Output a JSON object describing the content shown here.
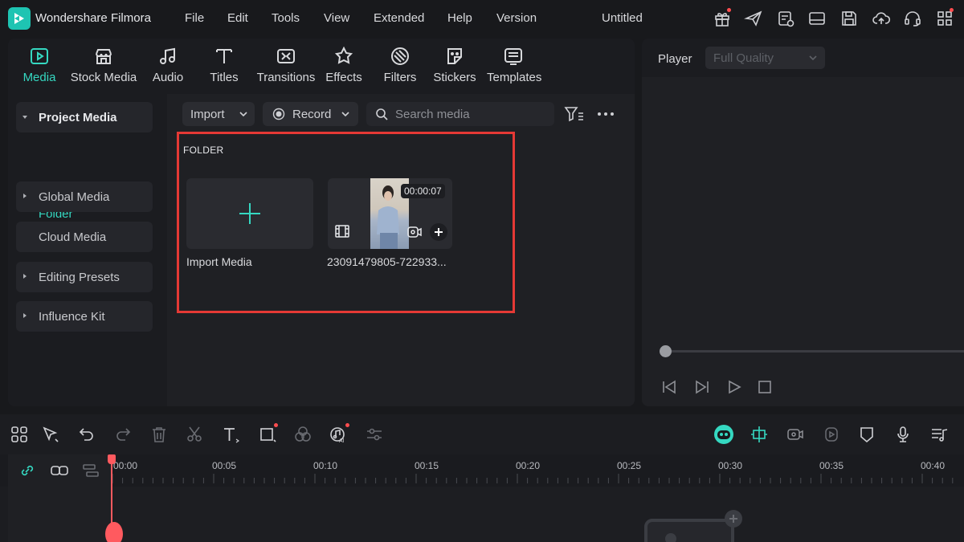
{
  "app": {
    "name": "Wondershare Filmora",
    "document_title": "Untitled"
  },
  "menu": [
    "File",
    "Edit",
    "Tools",
    "View",
    "Extended",
    "Help",
    "Version"
  ],
  "media_toolbar": {
    "items": [
      {
        "label": "Media",
        "icon": "media-icon",
        "active": true
      },
      {
        "label": "Stock Media",
        "icon": "stock-media-icon"
      },
      {
        "label": "Audio",
        "icon": "audio-icon"
      },
      {
        "label": "Titles",
        "icon": "titles-icon"
      },
      {
        "label": "Transitions",
        "icon": "transitions-icon"
      },
      {
        "label": "Effects",
        "icon": "effects-icon"
      },
      {
        "label": "Filters",
        "icon": "filters-icon"
      },
      {
        "label": "Stickers",
        "icon": "stickers-icon"
      },
      {
        "label": "Templates",
        "icon": "templates-icon"
      }
    ]
  },
  "sidebar": {
    "items": [
      {
        "label": "Project Media",
        "expanded": true
      },
      {
        "label": "Folder",
        "selected": true
      },
      {
        "label": "Global Media"
      },
      {
        "label": "Cloud Media"
      },
      {
        "label": "Editing Presets"
      },
      {
        "label": "Influence Kit"
      }
    ]
  },
  "media_bar": {
    "import_label": "Import",
    "record_label": "Record",
    "search_placeholder": "Search media"
  },
  "folder": {
    "title": "FOLDER",
    "import_tile_label": "Import Media",
    "clip": {
      "name": "23091479805-722933...",
      "duration": "00:00:07"
    }
  },
  "player": {
    "title": "Player",
    "quality": "Full Quality"
  },
  "timeline": {
    "ruler_labels": [
      "00:00",
      "00:05",
      "00:10",
      "00:15",
      "00:20",
      "00:25",
      "00:30",
      "00:35",
      "00:40"
    ]
  },
  "colors": {
    "accent": "#35d8c1",
    "highlight_border": "#e53935",
    "playhead": "#ff5a5f"
  }
}
